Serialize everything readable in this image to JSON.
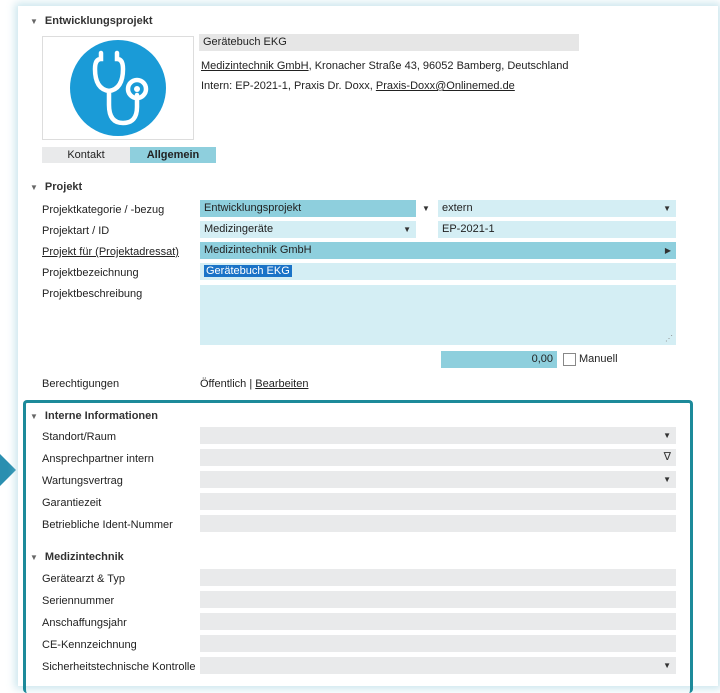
{
  "header": {
    "section_title": "Entwicklungsprojekt",
    "device_title": "Gerätebuch EKG",
    "address_company": "Medizintechnik GmbH",
    "address_rest": ", Kronacher Straße 43, 96052 Bamberg, Deutschland",
    "intern_prefix": "Intern: EP-2021-1, Praxis Dr. Doxx, ",
    "intern_email": "Praxis-Doxx@Onlinemed.de",
    "tab_kontakt": "Kontakt",
    "tab_allgemein": "Allgemein"
  },
  "projekt": {
    "title": "Projekt",
    "kategorie_label": "Projektkategorie / -bezug",
    "kategorie_value": "Entwicklungsprojekt",
    "bezug_value": "extern",
    "art_label": "Projektart / ID",
    "art_value": "Medizingeräte",
    "id_value": "EP-2021-1",
    "fuer_label": "Projekt für (Projektadressat)",
    "fuer_value": "Medizintechnik GmbH",
    "bezeichnung_label": "Projektbezeichnung",
    "bezeichnung_value": "Gerätebuch EKG",
    "beschreibung_label": "Projektbeschreibung",
    "amount_value": "0,00",
    "manuell_label": "Manuell",
    "berechtigungen_label": "Berechtigungen",
    "berechtigungen_value": "Öffentlich | ",
    "bearbeiten_link": "Bearbeiten"
  },
  "interne": {
    "title": "Interne Informationen",
    "fields": [
      "Standort/Raum",
      "Ansprechpartner intern",
      "Wartungsvertrag",
      "Garantiezeit",
      "Betriebliche Ident-Nummer"
    ]
  },
  "medizin": {
    "title": "Medizintechnik",
    "fields": [
      "Gerätearzt & Typ",
      "Seriennummer",
      "Anschaffungsjahr",
      "CE-Kennzeichnung",
      "Sicherheitstechnische Kontrolle"
    ]
  },
  "icons": {
    "device_logo": "stethoscope-icon"
  },
  "colors": {
    "accent": "#8ecfdd",
    "highlight": "#1a73c7",
    "frame_border": "#1d8a9a",
    "logo_bg": "#1a9bd7",
    "arrow": "#2a8fb0"
  }
}
